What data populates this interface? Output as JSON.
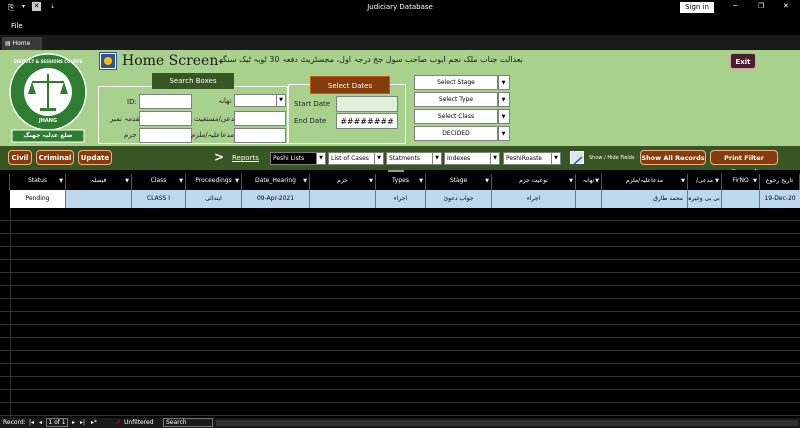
{
  "window": {
    "title": "Judiciary Database",
    "sign_in": "Sign in"
  },
  "menu": {
    "file": "File"
  },
  "tab": {
    "label": "Home"
  },
  "header": {
    "screen_title": "Home Screen",
    "urdu_banner": "بعدالت جناب ملک نجم ایوب صاحب سول جج درجہ اول، مجسٹریٹ دفعہ 30 ٹوبہ ٹیک سنگھ",
    "logo_text": "DISTRICT & SESSIONS COURTS",
    "logo_city": "JHANG",
    "logo_urdu": "ضلع عدلیہ جھنگ",
    "exit": "Exit"
  },
  "search": {
    "title": "Search Boxes",
    "id_label": "ID:",
    "thana_label": "تھانہ",
    "case_no_label": "مقدمہ نمبر",
    "plaintiff_label": "مدعی/مستغیث",
    "crime_label": "جرم",
    "accused_label": "مدعاعلیہ/ملزم"
  },
  "dates": {
    "title": "Select Dates",
    "start_label": "Start Date",
    "end_label": "End Date",
    "end_value": "########"
  },
  "selectors": {
    "stage": "Select Stage",
    "type": "Select Type",
    "class": "Select Class",
    "decided": "DECIDED"
  },
  "toolbar": {
    "civil": "Civil",
    "criminal": "Criminal",
    "update": "Update",
    "arrow": ">",
    "reports": "Reports",
    "peshi_lists": "Peshi Lists",
    "list_of_cases": "List of Cases",
    "statments": "Statments",
    "indexes": "Indexes",
    "peshi_roaster": "PeshiRoaste",
    "show_hide": "Show / Hide Fields",
    "show_all": "Show All Records",
    "print_filter": "Print Filter Record"
  },
  "grid": {
    "columns": [
      "Status",
      "فیصلہ",
      "Class",
      "Proceedings",
      "Date_Hearing",
      "جرم",
      "Types",
      "Stage",
      "نوعیت جرم",
      "تھانہ",
      "مدعاعلیہ/ملزم",
      "مدعی/مستغیث",
      "FirNO",
      "تاریخ رجوع"
    ],
    "rows": [
      [
        "Pending",
        "",
        "CLASS I",
        "ابتدائی",
        "09-Apr-2021",
        "",
        "اجراء",
        "جواب دعویٰ",
        "اجراء",
        "",
        "محمد طارق",
        "مسرت بی بی وغیرہ",
        "",
        "19-Dec-20"
      ]
    ]
  },
  "status": {
    "record_label": "Record:",
    "record_pos": "1 of 1",
    "filter": "Unfiltered",
    "search": "Search"
  },
  "colors": {
    "accent_green": "#a9d18e",
    "dark_green": "#375623",
    "brown": "#843c0c",
    "selected_row": "#bdd7ee"
  }
}
